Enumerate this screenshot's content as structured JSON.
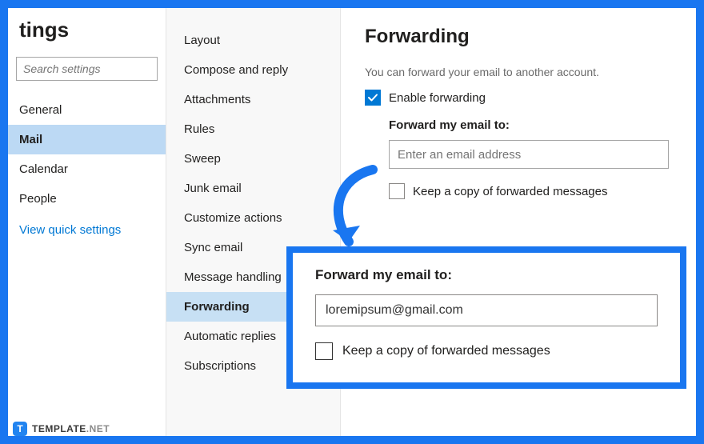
{
  "nav": {
    "title": "tings",
    "search_placeholder": "Search settings",
    "items": [
      {
        "label": "General"
      },
      {
        "label": "Mail"
      },
      {
        "label": "Calendar"
      },
      {
        "label": "People"
      }
    ],
    "quick_link": "View quick settings"
  },
  "subnav": {
    "items": [
      {
        "label": "Layout"
      },
      {
        "label": "Compose and reply"
      },
      {
        "label": "Attachments"
      },
      {
        "label": "Rules"
      },
      {
        "label": "Sweep"
      },
      {
        "label": "Junk email"
      },
      {
        "label": "Customize actions"
      },
      {
        "label": "Sync email"
      },
      {
        "label": "Message handling"
      },
      {
        "label": "Forwarding"
      },
      {
        "label": "Automatic replies"
      },
      {
        "label": "Subscriptions"
      }
    ]
  },
  "main": {
    "title": "Forwarding",
    "description": "You can forward your email to another account.",
    "enable_label": "Enable forwarding",
    "forward_label": "Forward my email to:",
    "email_placeholder": "Enter an email address",
    "keep_label": "Keep a copy of forwarded messages"
  },
  "callout": {
    "label": "Forward my email to:",
    "email_value": "loremipsum@gmail.com",
    "keep_label": "Keep a copy of forwarded messages"
  },
  "brand": {
    "badge": "T",
    "name": "TEMPLATE",
    "suffix": ".NET"
  },
  "colors": {
    "accent": "#1976f0",
    "primary": "#0078d4"
  }
}
